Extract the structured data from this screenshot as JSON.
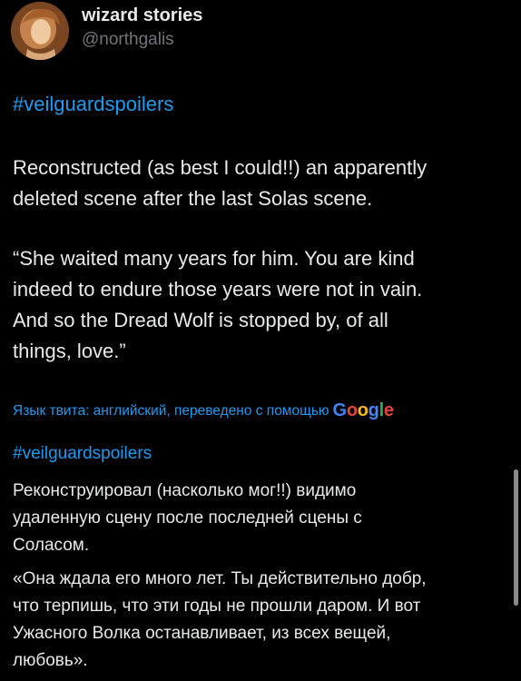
{
  "author": {
    "display_name": "wizard stories",
    "handle": "@northgalis",
    "avatar_icon": "avatar-portrait"
  },
  "tweet": {
    "hashtag": "#veilguardspoilers",
    "paragraphs": [
      "Reconstructed (as best I could!!) an apparently\ndeleted scene after the last Solas scene.",
      "“She waited many years for him. You are kind\nindeed to endure those years were not in vain.\nAnd so the Dread Wolf is stopped by, of all\nthings, love.”"
    ]
  },
  "translation": {
    "note": "Язык твита: английский, переведено с помощью",
    "provider": "Google",
    "hashtag": "#veilguardspoilers",
    "paragraphs": [
      "Реконструировал (насколько мог!!) видимо\nудаленную сцену после последней сцены с\nСоласом.",
      "«Она ждала его много лет. Ты действительно добр,\nчто терпишь, что эти годы не прошли даром. И вот\nУжасного Волка останавливает, из всех вещей,\nлюбовь»."
    ]
  },
  "colors": {
    "background": "#000000",
    "text": "#e7e9ea",
    "secondary": "#71767b",
    "link": "#1d9bf0"
  }
}
